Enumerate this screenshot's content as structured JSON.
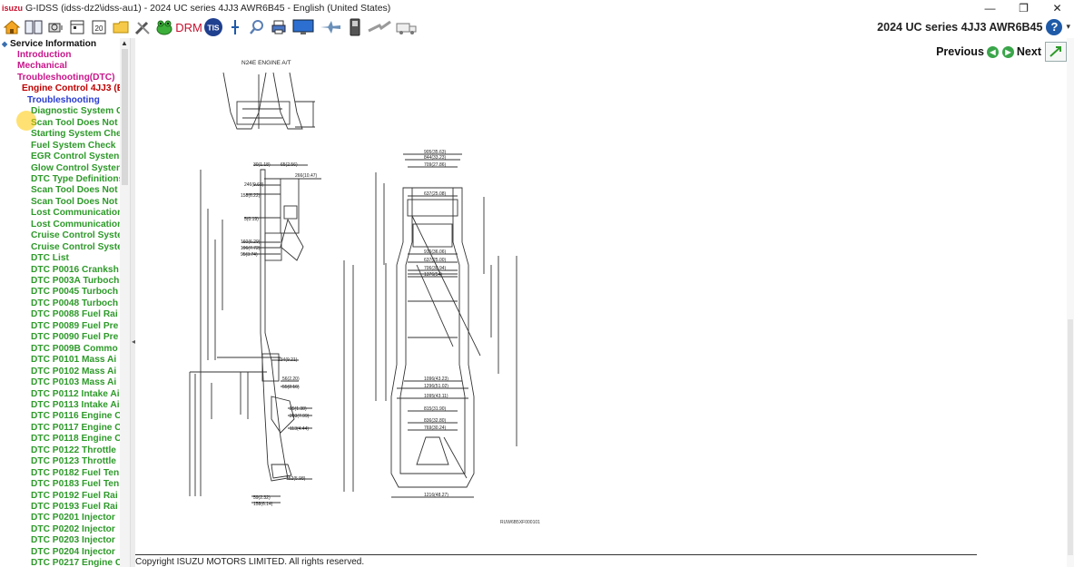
{
  "window": {
    "app_logo": "isuzu",
    "title": "G-IDSS (idss-dz2\\idss-au1) - 2024 UC series 4JJ3 AWR6B45 - English (United States)",
    "minimize": "—",
    "maximize": "❐",
    "close": "✕"
  },
  "toolbar": {
    "icons": [
      "home-icon",
      "book-icon",
      "engine-diag-icon",
      "calendar-icon",
      "date-20-icon",
      "folder-icon",
      "tools-icon",
      "frog-icon",
      "drm-icon",
      "tis-icon",
      "pin-icon",
      "magnifier-icon",
      "printer-icon",
      "monitor-icon",
      "plane-icon",
      "phone-icon",
      "arrow-icon",
      "truck-icon"
    ],
    "drm_label": "DRM",
    "tis_label": "TIS",
    "date_label": "20",
    "model_title": "2024 UC series 4JJ3 AWR6B45",
    "help": "?"
  },
  "tree": {
    "root": "Service Information",
    "items": [
      {
        "label": "Introduction",
        "style": "pink",
        "indent": 1
      },
      {
        "label": "Mechanical",
        "style": "pink",
        "indent": 1
      },
      {
        "label": "Troubleshooting(DTC)",
        "style": "pink",
        "indent": 1
      },
      {
        "label": "Engine Control 4JJ3 (E",
        "style": "red",
        "indent": 2
      },
      {
        "label": "Troubleshooting",
        "style": "blue",
        "indent": 3
      },
      {
        "label": "Diagnostic System C",
        "style": "green",
        "indent": 4
      },
      {
        "label": "Scan Tool Does Not",
        "style": "green",
        "indent": 4
      },
      {
        "label": "Starting System Che",
        "style": "green",
        "indent": 4
      },
      {
        "label": "Fuel System Check",
        "style": "green",
        "indent": 4
      },
      {
        "label": "EGR Control Systen",
        "style": "green",
        "indent": 4
      },
      {
        "label": "Glow Control Systen",
        "style": "green",
        "indent": 4
      },
      {
        "label": "DTC Type Definitions",
        "style": "green",
        "indent": 4
      },
      {
        "label": "Scan Tool Does Not",
        "style": "green",
        "indent": 4
      },
      {
        "label": "Scan Tool Does Not",
        "style": "green",
        "indent": 4
      },
      {
        "label": "Lost Communication",
        "style": "green",
        "indent": 4
      },
      {
        "label": "Lost Communication",
        "style": "green",
        "indent": 4
      },
      {
        "label": "Cruise Control Syste",
        "style": "green",
        "indent": 4
      },
      {
        "label": "Cruise Control Syste",
        "style": "green",
        "indent": 4
      },
      {
        "label": "DTC List",
        "style": "green",
        "indent": 4
      },
      {
        "label": "DTC P0016 Cranksh",
        "style": "green",
        "indent": 4
      },
      {
        "label": "DTC P003A Turboch",
        "style": "green",
        "indent": 4
      },
      {
        "label": "DTC P0045 Turboch",
        "style": "green",
        "indent": 4
      },
      {
        "label": "DTC P0048 Turboch",
        "style": "green",
        "indent": 4
      },
      {
        "label": "DTC P0088 Fuel Rai",
        "style": "green",
        "indent": 4
      },
      {
        "label": "DTC P0089 Fuel Pre",
        "style": "green",
        "indent": 4
      },
      {
        "label": "DTC P0090 Fuel Pre",
        "style": "green",
        "indent": 4
      },
      {
        "label": "DTC P009B Commo",
        "style": "green",
        "indent": 4
      },
      {
        "label": "DTC P0101 Mass Ai",
        "style": "green",
        "indent": 4
      },
      {
        "label": "DTC P0102 Mass Ai",
        "style": "green",
        "indent": 4
      },
      {
        "label": "DTC P0103 Mass Ai",
        "style": "green",
        "indent": 4
      },
      {
        "label": "DTC P0112 Intake Ai",
        "style": "green",
        "indent": 4
      },
      {
        "label": "DTC P0113 Intake Ai",
        "style": "green",
        "indent": 4
      },
      {
        "label": "DTC P0116 Engine C",
        "style": "green",
        "indent": 4
      },
      {
        "label": "DTC P0117 Engine C",
        "style": "green",
        "indent": 4
      },
      {
        "label": "DTC P0118 Engine C",
        "style": "green",
        "indent": 4
      },
      {
        "label": "DTC P0122 Throttle",
        "style": "green",
        "indent": 4
      },
      {
        "label": "DTC P0123 Throttle",
        "style": "green",
        "indent": 4
      },
      {
        "label": "DTC P0182 Fuel Ten",
        "style": "green",
        "indent": 4
      },
      {
        "label": "DTC P0183 Fuel Ten",
        "style": "green",
        "indent": 4
      },
      {
        "label": "DTC P0192 Fuel Rai",
        "style": "green",
        "indent": 4
      },
      {
        "label": "DTC P0193 Fuel Rai",
        "style": "green",
        "indent": 4
      },
      {
        "label": "DTC P0201 Injector",
        "style": "green",
        "indent": 4
      },
      {
        "label": "DTC P0202 Injector",
        "style": "green",
        "indent": 4
      },
      {
        "label": "DTC P0203 Injector",
        "style": "green",
        "indent": 4
      },
      {
        "label": "DTC P0204 Injector",
        "style": "green",
        "indent": 4
      },
      {
        "label": "DTC P0217 Engine C",
        "style": "green",
        "indent": 4
      }
    ]
  },
  "navigation": {
    "previous": "Previous",
    "next": "Next"
  },
  "figure": {
    "header": "N24E ENGINE A/T",
    "code": "RUW6B5XF000101",
    "dims_side": [
      "30(1.18)",
      "65(2.56)",
      "266(10.47)",
      "246(9.68)",
      "158(6.22)",
      "5(0.19)",
      "160(6.29)",
      "196(7.72)",
      "95(3.74)",
      "234(9.21)",
      "56(2.20)",
      "55(2.16)",
      "25(1.38)",
      "203(7.99)",
      "113(4.44)",
      "152(5.98)",
      "59(2.32)",
      "158(6.14)"
    ],
    "dims_top": [
      "905(35.63)",
      "844(33.23)",
      "709(27.86)",
      "637(25.08)",
      "916(36.06)",
      "637(25.00)",
      "706(30.94)",
      "1376(54)",
      "1096(43.23)",
      "1296(51.02)",
      "1095(43.11)",
      "815(31.90)",
      "836(32.80)",
      "769(30.24)",
      "1216(48.27)"
    ]
  },
  "footer": {
    "copyright": "Copyright ISUZU MOTORS LIMITED. All rights reserved."
  },
  "colors": {
    "pink": "#c8178a",
    "red": "#c00000",
    "blue": "#2b3cd0",
    "green": "#2e9a2a",
    "nav_green": "#3aa54a",
    "help_blue": "#1f5aa8"
  }
}
